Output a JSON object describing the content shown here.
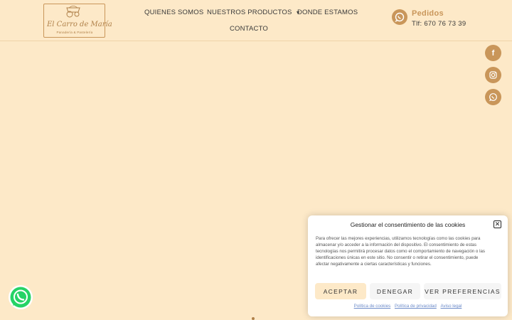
{
  "brand": {
    "logo_script": "El Carro de María",
    "logo_subtitle": "Panadería & Pastelería"
  },
  "nav": {
    "quienes": "QUIENES SOMOS",
    "productos": "NUESTROS PRODUCTOS",
    "donde": "DONDE ESTAMOS",
    "contacto": "CONTACTO"
  },
  "orders": {
    "title": "Pedidos",
    "phone": "Tlf: 670 76 73 39",
    "icon": "whatsapp-icon"
  },
  "social": [
    {
      "name": "facebook-icon",
      "glyph": "f"
    },
    {
      "name": "instagram-icon",
      "glyph": "◎"
    },
    {
      "name": "whatsapp-icon",
      "glyph": "✆"
    }
  ],
  "cookie": {
    "title": "Gestionar el consentimiento de las cookies",
    "text": "Para ofrecer las mejores experiencias, utilizamos tecnologías como las cookies para almacenar y/o acceder a la información del dispositivo. El consentimiento de estas tecnologías nos permitirá procesar datos como el comportamiento de navegación o las identificaciones únicas en este sitio. No consentir o retirar el consentimiento, puede afectar negativamente a ciertas características y funciones.",
    "accept": "ACEPTAR",
    "deny": "DENEGAR",
    "prefs": "VER PREFERENCIAS",
    "links": [
      "Política de cookies",
      "Política de privacidad",
      "Aviso legal"
    ]
  },
  "colors": {
    "background": "#fde9c8",
    "accent": "#c9965a",
    "whatsapp": "#25d366"
  }
}
